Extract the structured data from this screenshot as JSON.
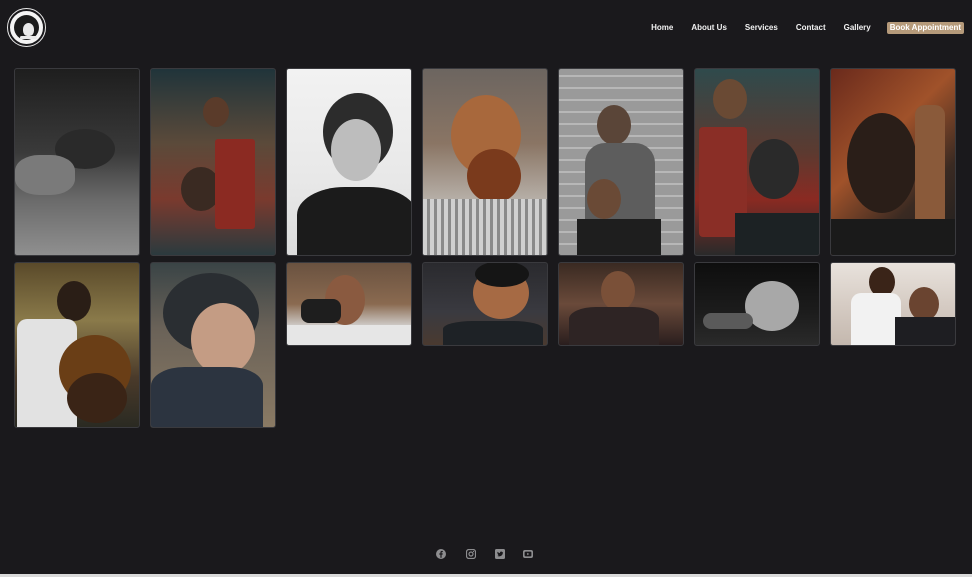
{
  "brand": {
    "logo_icon": "barbershop-logo"
  },
  "nav": {
    "items": [
      {
        "label": "Home"
      },
      {
        "label": "About Us"
      },
      {
        "label": "Services"
      },
      {
        "label": "Contact"
      },
      {
        "label": "Gallery"
      }
    ],
    "cta_label": "Book Appointment",
    "cta_color": "#b59a7a"
  },
  "gallery": {
    "photos": [
      {
        "subject": "client reclining with black cape, black and white"
      },
      {
        "subject": "barber in red apron styling seated client"
      },
      {
        "subject": "profile of man with textured haircut, white background"
      },
      {
        "subject": "bearded man having beard trimmed with scissors"
      },
      {
        "subject": "masked barber cutting client hair against brick wall"
      },
      {
        "subject": "barber spraying client hair in barbershop"
      },
      {
        "subject": "tattooed barber styling bearded client"
      },
      {
        "subject": "barber trimming client curly hair"
      },
      {
        "subject": "back view of slicked hairstyle with part line"
      },
      {
        "subject": "barber in black gloves shaving bearded client"
      },
      {
        "subject": "young man with fade haircut"
      },
      {
        "subject": "client in cape with fresh haircut"
      },
      {
        "subject": "silver styled hair close-up"
      },
      {
        "subject": "barber cutting child hair in bright salon"
      }
    ]
  },
  "footer": {
    "social_icons": [
      "facebook-icon",
      "instagram-icon",
      "twitter-icon",
      "youtube-icon"
    ],
    "icon_color": "#8d8d8f"
  },
  "colors": {
    "background": "#1a191c",
    "accent": "#b59a7a"
  }
}
